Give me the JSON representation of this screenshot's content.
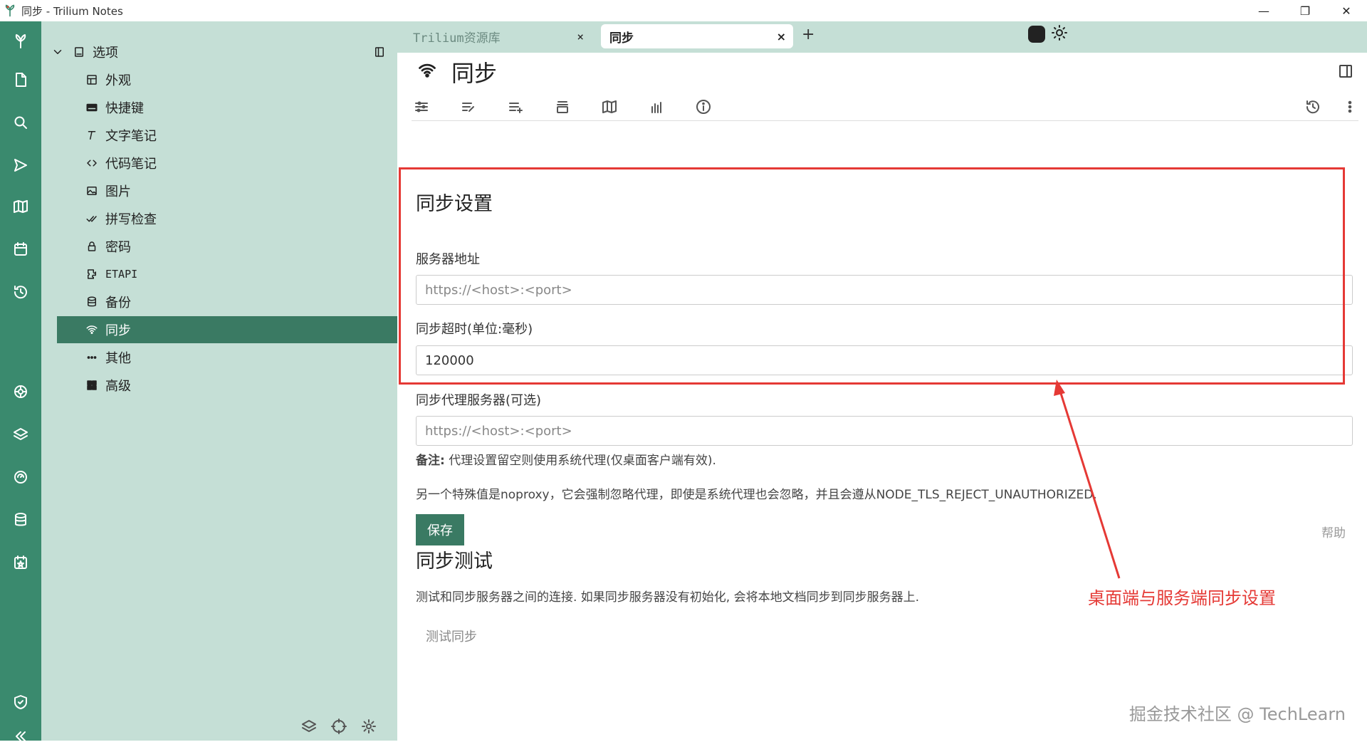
{
  "window": {
    "title": "同步 - Trilium Notes",
    "min": "—",
    "max": "❐",
    "close": "✕"
  },
  "tree": {
    "root": "选项",
    "items": [
      {
        "label": "外观"
      },
      {
        "label": "快捷键"
      },
      {
        "label": "文字笔记"
      },
      {
        "label": "代码笔记"
      },
      {
        "label": "图片"
      },
      {
        "label": "拼写检查"
      },
      {
        "label": "密码"
      },
      {
        "label": "ETAPI"
      },
      {
        "label": "备份"
      },
      {
        "label": "同步"
      },
      {
        "label": "其他"
      },
      {
        "label": "高级"
      }
    ]
  },
  "tabs": [
    {
      "label": "Trilium资源库",
      "close": "×"
    },
    {
      "label": "同步",
      "close": "×"
    }
  ],
  "tab_add": "+",
  "note": {
    "title": "同步"
  },
  "sync_settings": {
    "heading": "同步设置",
    "server_label": "服务器地址",
    "server_placeholder": "https://<host>:<port>",
    "timeout_label": "同步超时(单位:毫秒)",
    "timeout_value": "120000",
    "proxy_label": "同步代理服务器(可选)",
    "proxy_placeholder": "https://<host>:<port>",
    "note_bold": "备注:",
    "note_text": " 代理设置留空则使用系统代理(仅桌面客户端有效).",
    "noproxy_text": "另一个特殊值是noproxy，它会强制忽略代理，即使是系统代理也会忽略，并且会遵从NODE_TLS_REJECT_UNAUTHORIZED.",
    "save": "保存",
    "help": "帮助"
  },
  "sync_test": {
    "heading": "同步测试",
    "description": "测试和同步服务器之间的连接. 如果同步服务器没有初始化, 会将本地文档同步到同步服务器上.",
    "button": "测试同步"
  },
  "annotation": {
    "callout": "桌面端与服务端同步设置",
    "color": "#e53935"
  },
  "watermark": "掘金技术社区 @ TechLearn",
  "colors": {
    "launcher": "#3a8a6e",
    "tree_bg": "#c5dfd6",
    "active_item": "#3a7a63",
    "accent": "#3a7a63"
  }
}
